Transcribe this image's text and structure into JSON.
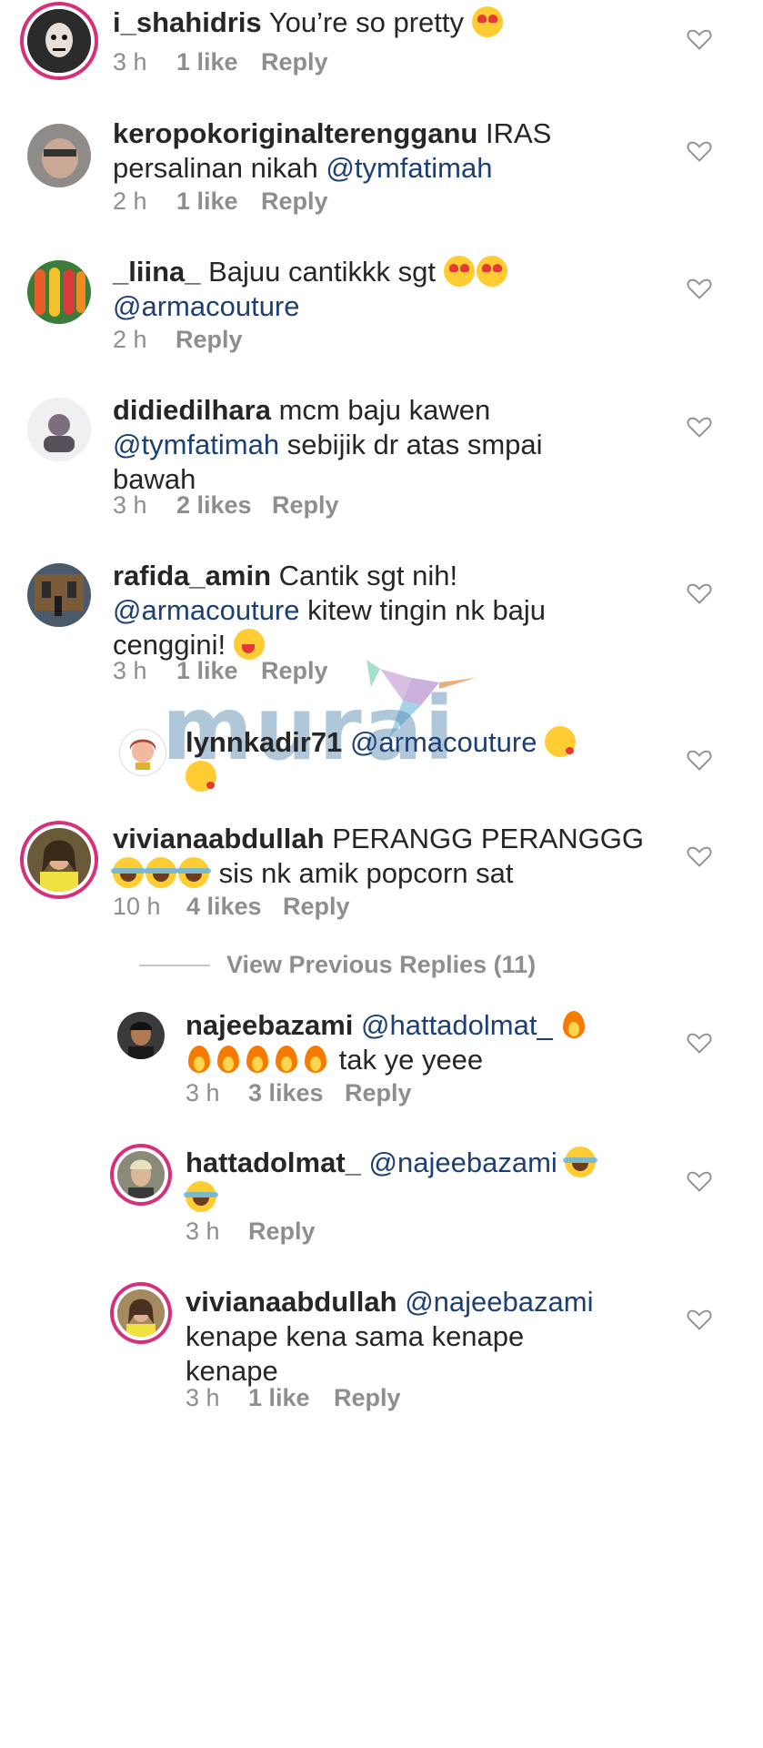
{
  "comments": [
    {
      "user": "i_shahidris",
      "text": "You’re so pretty",
      "emoji": [
        "heart-eyes"
      ],
      "time": "3 h",
      "likes": "1 like",
      "reply": "Reply"
    },
    {
      "user": "keropokoriginalterengganu",
      "text": "IRAS",
      "text2": "persalinan nikah",
      "mention": "@tymfatimah",
      "time": "2 h",
      "likes": "1 like",
      "reply": "Reply"
    },
    {
      "user": "_liina_",
      "text": "Bajuu cantikkk sgt",
      "emoji": [
        "heart-eyes",
        "heart-eyes"
      ],
      "mention": "@armacouture",
      "time": "2 h",
      "reply": "Reply"
    },
    {
      "user": "didiedilhara",
      "text": "mcm baju kawen",
      "mention": "@tymfatimah",
      "text2": "sebijik dr atas smpai",
      "text3": "bawah",
      "time": "3 h",
      "likes": "2 likes",
      "reply": "Reply"
    },
    {
      "user": "rafida_amin",
      "text": "Cantik sgt nih!",
      "mention": "@armacouture",
      "text2": "kitew tingin nk baju",
      "text3": "cenggini!",
      "emoji": [
        "wink"
      ],
      "time": "3 h",
      "likes": "1 like",
      "reply": "Reply"
    },
    {
      "user": "lynnkadir71",
      "mention": "@armacouture",
      "emoji": [
        "kiss",
        "kiss"
      ]
    },
    {
      "user": "vivianaabdullah",
      "text": "PERANGG PERANGGG",
      "emoji": [
        "laugh",
        "laugh",
        "laugh"
      ],
      "text2": "sis nk amik popcorn sat",
      "time": "10 h",
      "likes": "4 likes",
      "reply": "Reply"
    },
    {
      "user": "najeebazami",
      "mention": "@hattadolmat_",
      "text2": "tak ye yeee",
      "time": "3 h",
      "likes": "3 likes",
      "reply": "Reply"
    },
    {
      "user": "hattadolmat_",
      "mention": "@najeebazami",
      "time": "3 h",
      "reply": "Reply"
    },
    {
      "user": "vivianaabdullah",
      "mention": "@najeebazami",
      "text2": "kenape kena sama kenape",
      "text3": "kenape",
      "time": "3 h",
      "likes": "1 like",
      "reply": "Reply"
    }
  ],
  "view_previous_replies": "View Previous Replies (11)",
  "watermark": "murai",
  "colors": {
    "text": "#262626",
    "meta": "#8e8e8e",
    "mention": "#1d3f73",
    "story_ring": "#d6307a"
  }
}
